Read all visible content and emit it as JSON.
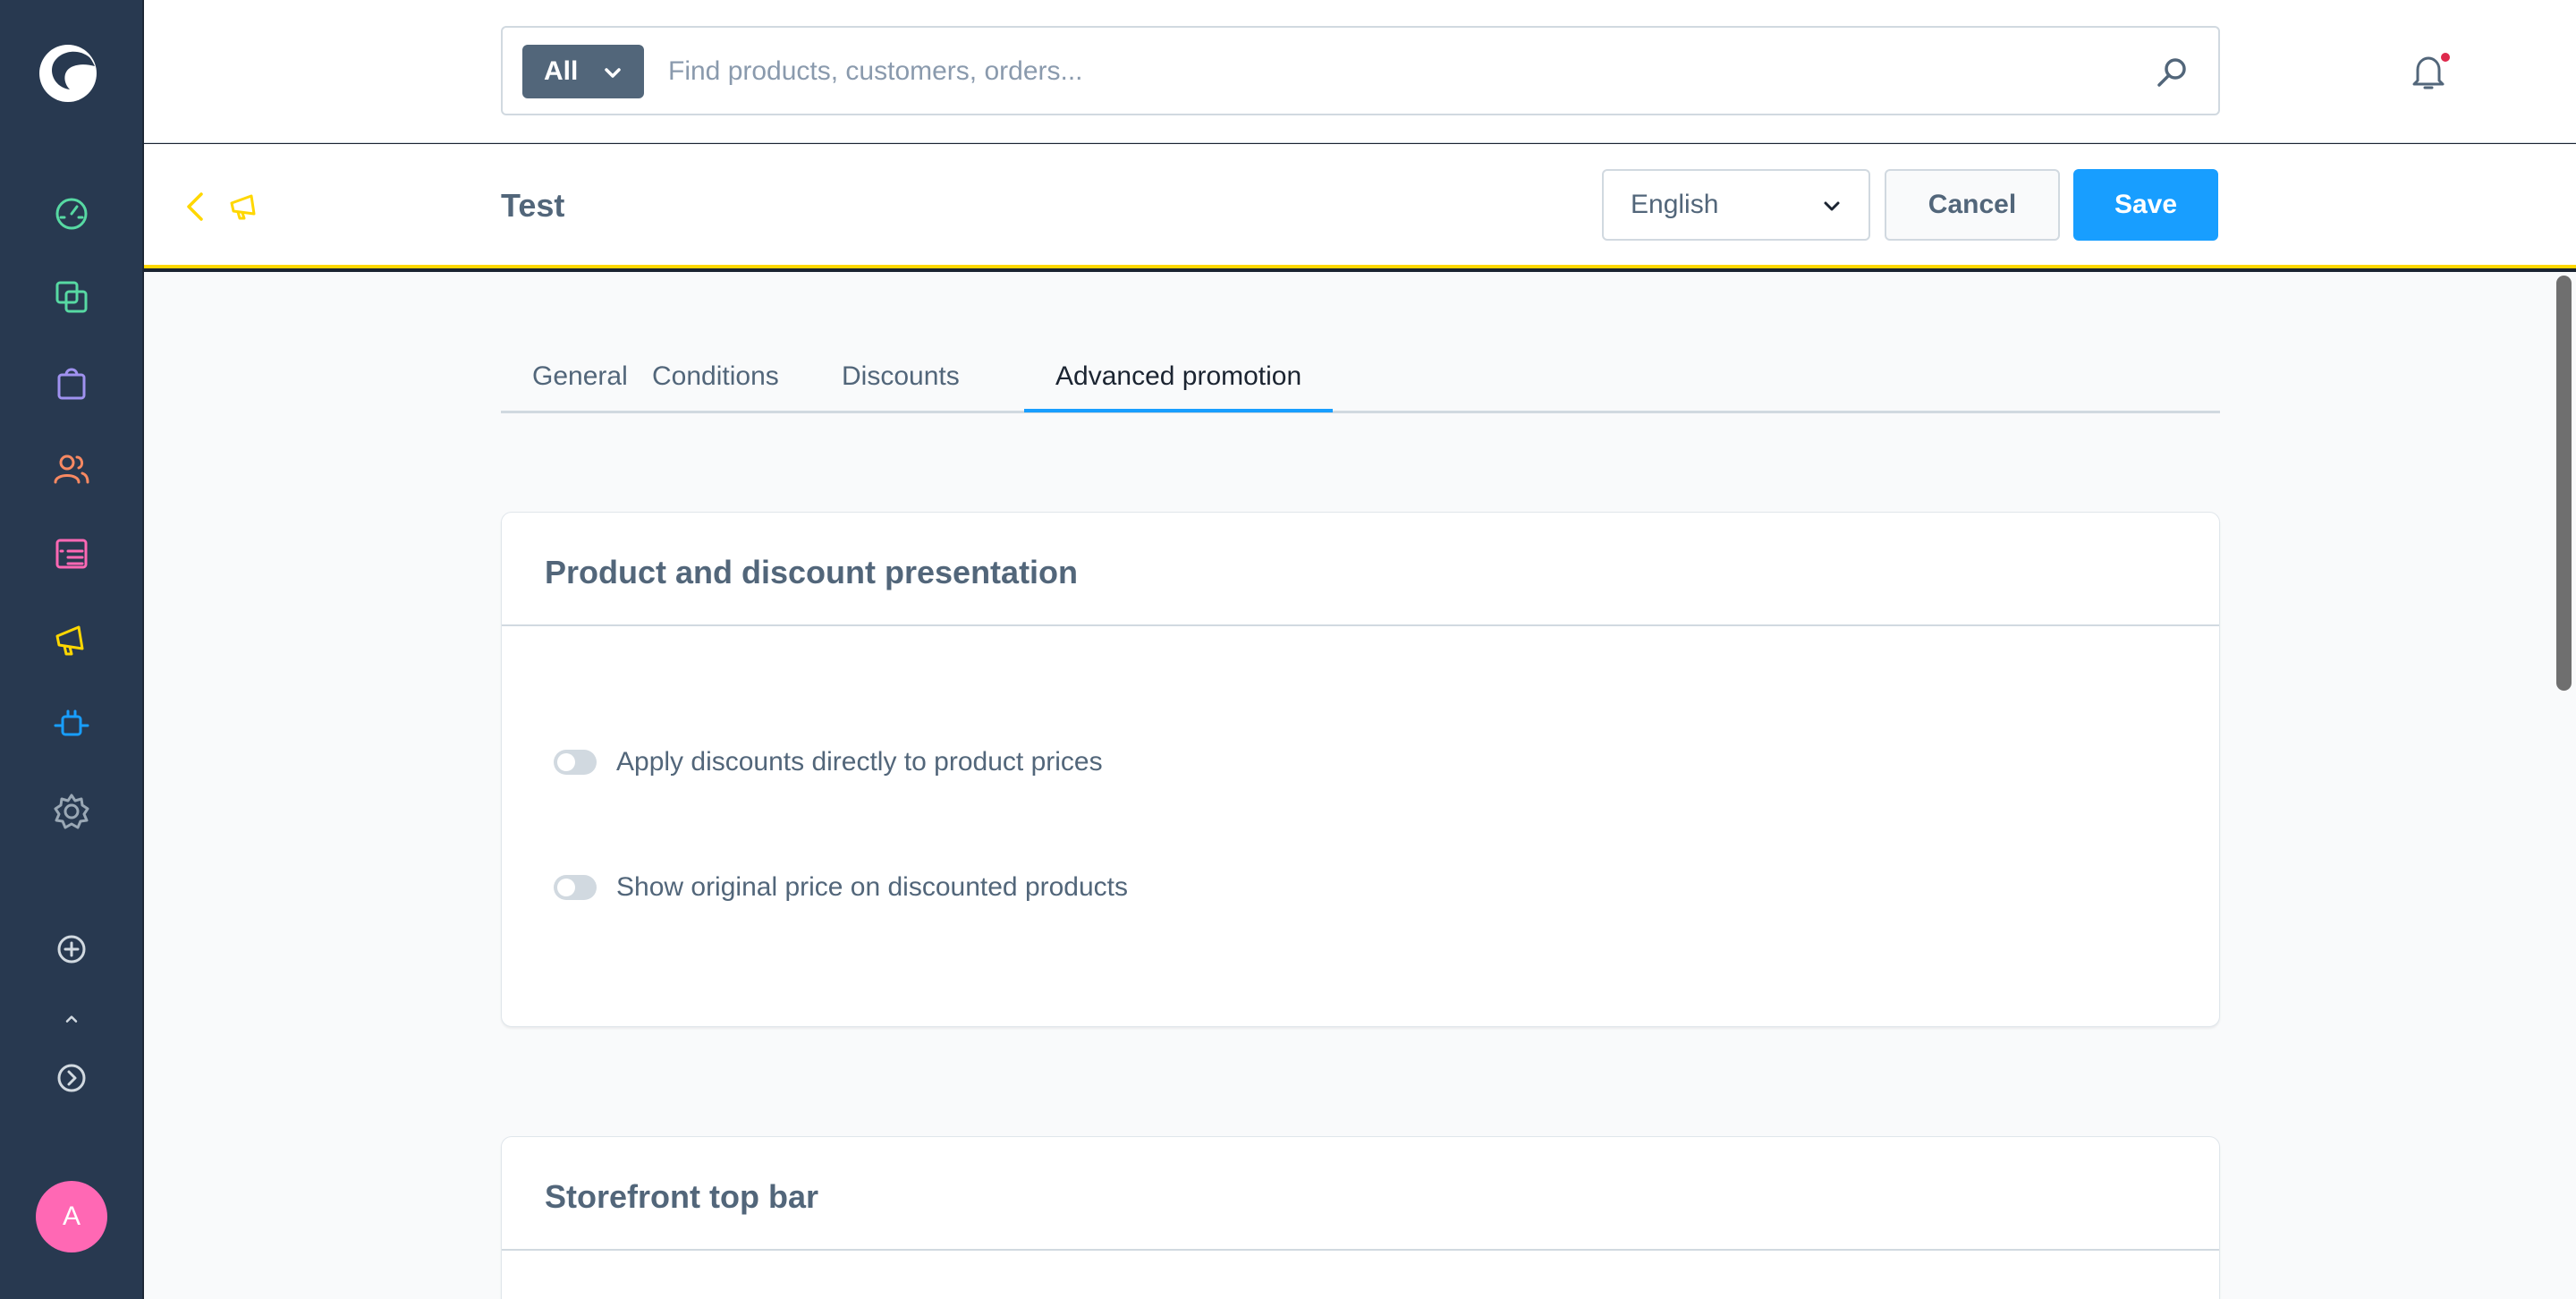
{
  "sidebar": {
    "items": [
      {
        "icon": "dashboard-icon",
        "color": "#57d9a3"
      },
      {
        "icon": "catalogues-icon",
        "color": "#57d9a3"
      },
      {
        "icon": "orders-icon",
        "color": "#a092f0"
      },
      {
        "icon": "customers-icon",
        "color": "#f88962"
      },
      {
        "icon": "content-icon",
        "color": "#ff68b4"
      },
      {
        "icon": "marketing-icon",
        "color": "#ffd700"
      },
      {
        "icon": "extensions-icon",
        "color": "#189eff"
      },
      {
        "icon": "settings-icon",
        "color": "#9aa8b5"
      }
    ],
    "avatar_initial": "A",
    "avatar_color": "#ff68b4"
  },
  "topbar": {
    "search_type": "All",
    "search_placeholder": "Find products, customers, orders..."
  },
  "smartbar": {
    "title": "Test",
    "language": "English",
    "cancel_label": "Cancel",
    "save_label": "Save",
    "accent_color": "#ffd700"
  },
  "tabs": [
    {
      "label": "General",
      "active": false
    },
    {
      "label": "Conditions",
      "active": false
    },
    {
      "label": "Discounts",
      "active": false
    },
    {
      "label": "Advanced promotion",
      "active": true
    }
  ],
  "cards": {
    "presentation": {
      "title": "Product and discount presentation",
      "switches": [
        {
          "label": "Apply discounts directly to product prices",
          "checked": false
        },
        {
          "label": "Show original price on discounted products",
          "checked": false
        }
      ]
    },
    "topbar": {
      "title": "Storefront top bar"
    }
  },
  "colors": {
    "primary": "#189eff",
    "sidebar_bg": "#283950",
    "text": "#52667a"
  }
}
